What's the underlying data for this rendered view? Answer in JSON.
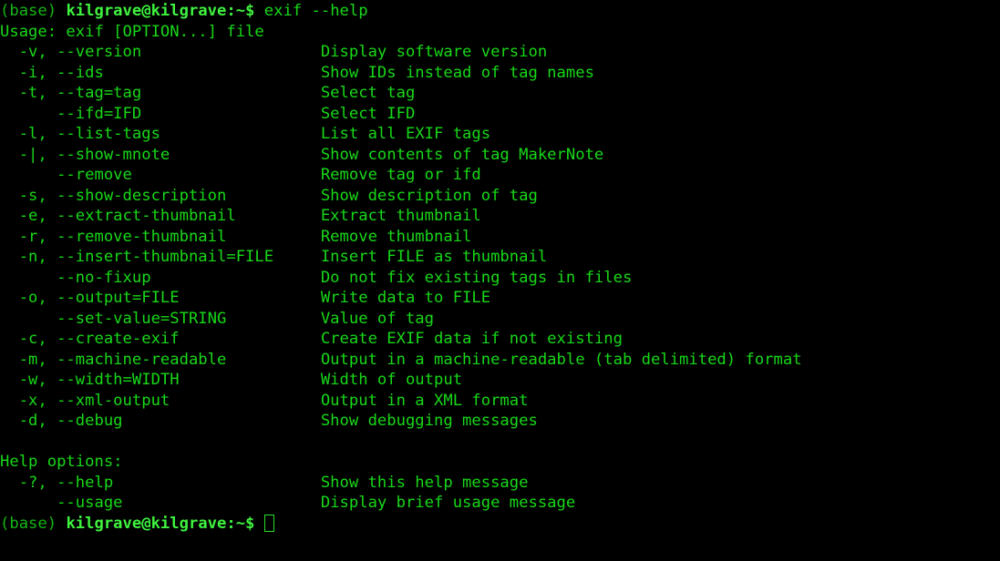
{
  "terminal": {
    "background_color": "#000000",
    "text_color": "#18d818",
    "prompt_bold_color": "#3ef23e",
    "cursor_color": "#28e028",
    "prompt": {
      "env": "(base) ",
      "user_host": "kilgrave@kilgrave",
      "path_sign": ":~$ "
    },
    "command_line": {
      "command": "exif --help"
    },
    "usage_line": "Usage: exif [OPTION...] file",
    "options": [
      {
        "flag": "  -v, --version",
        "description": "Display software version"
      },
      {
        "flag": "  -i, --ids",
        "description": "Show IDs instead of tag names"
      },
      {
        "flag": "  -t, --tag=tag",
        "description": "Select tag"
      },
      {
        "flag": "      --ifd=IFD",
        "description": "Select IFD"
      },
      {
        "flag": "  -l, --list-tags",
        "description": "List all EXIF tags"
      },
      {
        "flag": "  -|, --show-mnote",
        "description": "Show contents of tag MakerNote"
      },
      {
        "flag": "      --remove",
        "description": "Remove tag or ifd"
      },
      {
        "flag": "  -s, --show-description",
        "description": "Show description of tag"
      },
      {
        "flag": "  -e, --extract-thumbnail",
        "description": "Extract thumbnail"
      },
      {
        "flag": "  -r, --remove-thumbnail",
        "description": "Remove thumbnail"
      },
      {
        "flag": "  -n, --insert-thumbnail=FILE",
        "description": "Insert FILE as thumbnail"
      },
      {
        "flag": "      --no-fixup",
        "description": "Do not fix existing tags in files"
      },
      {
        "flag": "  -o, --output=FILE",
        "description": "Write data to FILE"
      },
      {
        "flag": "      --set-value=STRING",
        "description": "Value of tag"
      },
      {
        "flag": "  -c, --create-exif",
        "description": "Create EXIF data if not existing"
      },
      {
        "flag": "  -m, --machine-readable",
        "description": "Output in a machine-readable (tab delimited) format"
      },
      {
        "flag": "  -w, --width=WIDTH",
        "description": "Width of output"
      },
      {
        "flag": "  -x, --xml-output",
        "description": "Output in a XML format"
      },
      {
        "flag": "  -d, --debug",
        "description": "Show debugging messages"
      }
    ],
    "help_options_heading": "Help options:",
    "help_options": [
      {
        "flag": "  -?, --help",
        "description": "Show this help message"
      },
      {
        "flag": "      --usage",
        "description": "Display brief usage message"
      }
    ]
  }
}
